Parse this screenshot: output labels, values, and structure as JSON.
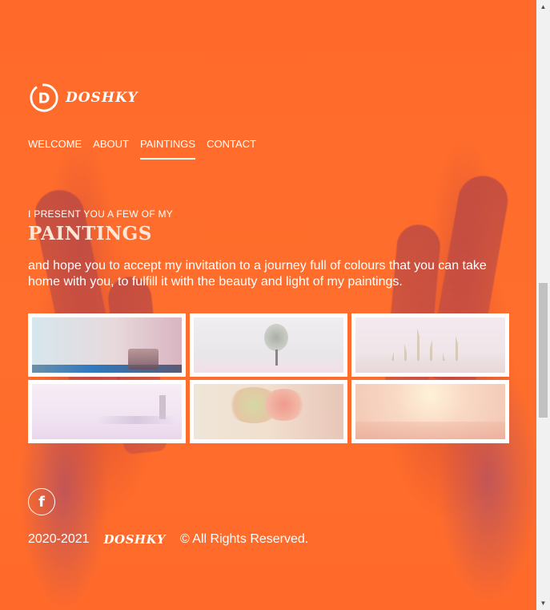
{
  "brand": {
    "name": "DOSHKY",
    "logo_letter": "D"
  },
  "nav": {
    "items": [
      {
        "label": "WELCOME"
      },
      {
        "label": "ABOUT"
      },
      {
        "label": "PAINTINGS"
      },
      {
        "label": "CONTACT"
      }
    ],
    "active": "PAINTINGS"
  },
  "intro": {
    "kicker": "I PRESENT YOU A FEW OF MY",
    "title": "PAINTINGS",
    "body": "and hope you to accept my invitation to a journey full of colours that you can take home with you, to fulfill it with the beauty and light of my paintings."
  },
  "gallery": {
    "items": [
      {
        "icon": "painting-thumbnail"
      },
      {
        "icon": "painting-thumbnail"
      },
      {
        "icon": "painting-thumbnail"
      },
      {
        "icon": "painting-thumbnail"
      },
      {
        "icon": "painting-thumbnail"
      },
      {
        "icon": "painting-thumbnail"
      }
    ]
  },
  "social": {
    "facebook_glyph": "f"
  },
  "footer": {
    "years": "2020-2021",
    "brand": "DOSHKY",
    "rights": "© All Rights Reserved."
  },
  "scrollbar": {
    "up_glyph": "▲",
    "down_glyph": "▼"
  },
  "colors": {
    "background": "#ff6a2a",
    "text": "#ffffff"
  }
}
